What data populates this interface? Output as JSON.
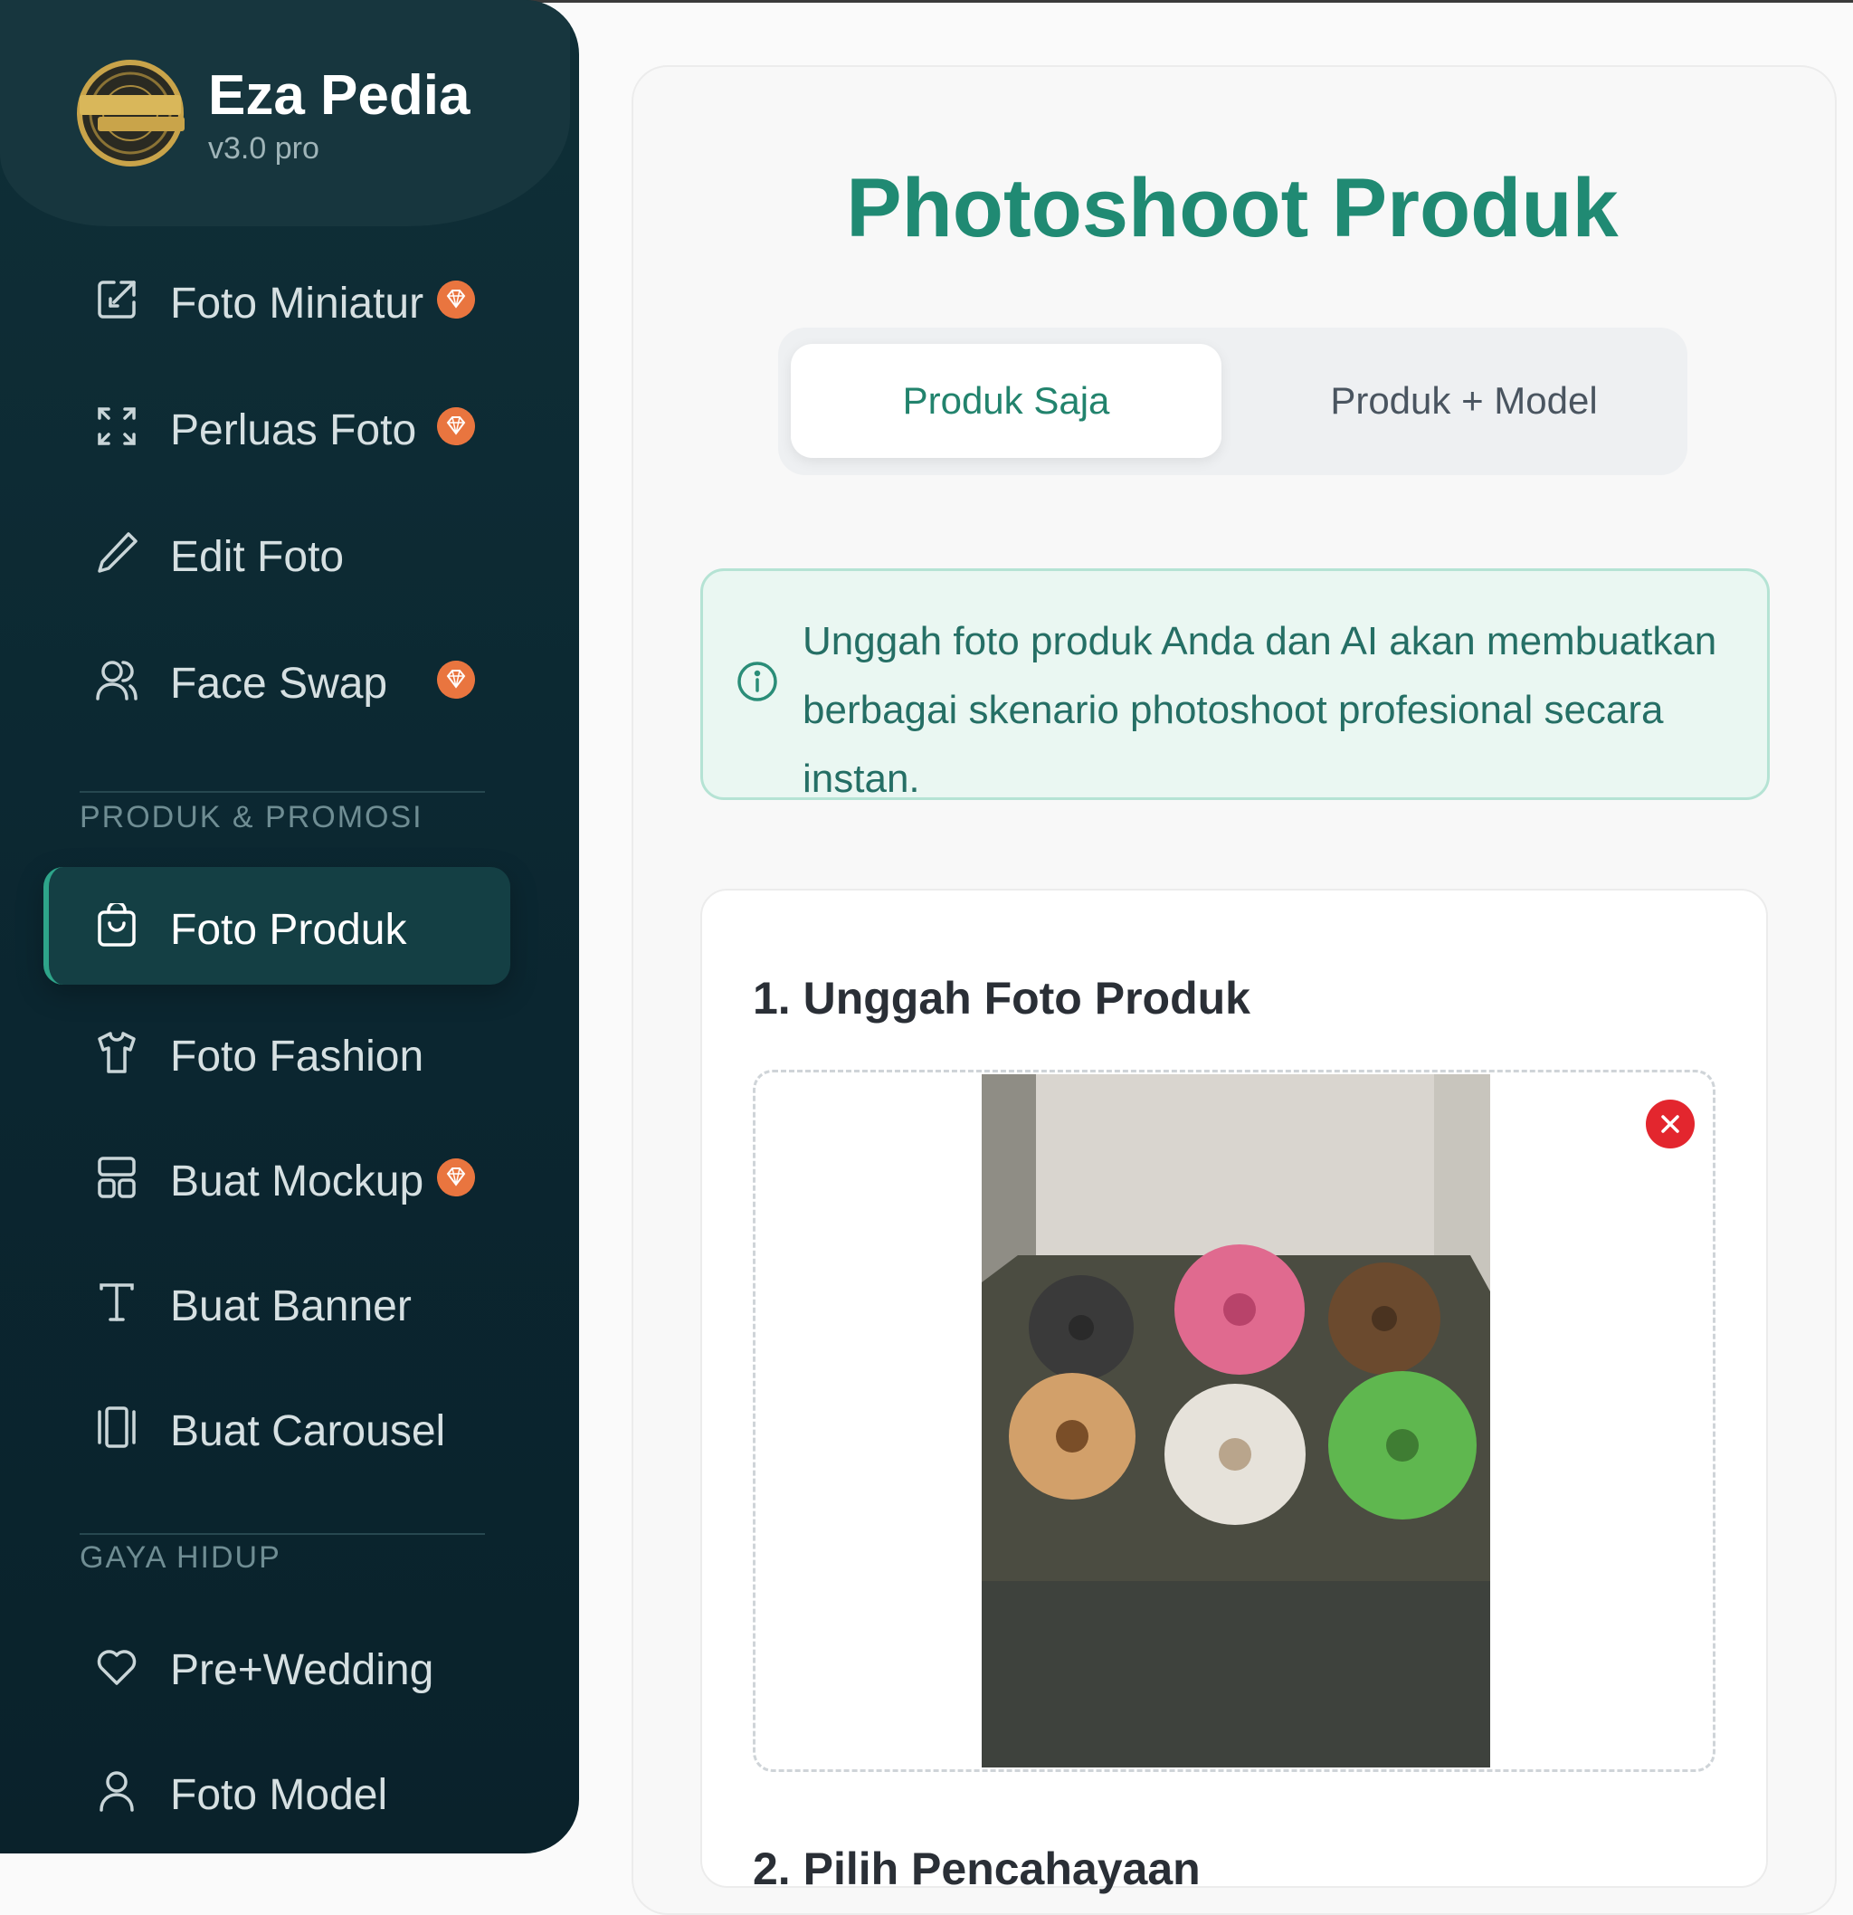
{
  "brand": {
    "title": "Eza Pedia",
    "version": "v3.0 pro",
    "logo_text": "EZA PEDIA PRO"
  },
  "sidebar": {
    "items": [
      {
        "label": "Foto Miniatur",
        "icon": "external-edit-icon",
        "premium": true
      },
      {
        "label": "Perluas Foto",
        "icon": "expand-icon",
        "premium": true
      },
      {
        "label": "Edit Foto",
        "icon": "pencil-icon",
        "premium": false
      },
      {
        "label": "Face Swap",
        "icon": "user-swap-icon",
        "premium": true
      }
    ],
    "section_produk": "PRODUK & PROMOSI",
    "produk_items": [
      {
        "label": "Foto Produk",
        "icon": "shopping-bag-icon",
        "active": true
      },
      {
        "label": "Foto Fashion",
        "icon": "shirt-icon"
      },
      {
        "label": "Buat Mockup",
        "icon": "layout-icon",
        "premium": true
      },
      {
        "label": "Buat Banner",
        "icon": "text-icon"
      },
      {
        "label": "Buat Carousel",
        "icon": "carousel-icon"
      }
    ],
    "section_gaya": "GAYA HIDUP",
    "gaya_items": [
      {
        "label": "Pre+Wedding",
        "icon": "heart-icon"
      },
      {
        "label": "Foto Model",
        "icon": "user-icon"
      }
    ]
  },
  "main": {
    "title": "Photoshoot Produk",
    "tabs": [
      {
        "label": "Produk Saja",
        "active": true
      },
      {
        "label": "Produk + Model",
        "active": false
      }
    ],
    "info_line1": "Unggah foto produk Anda dan AI akan membuatkan",
    "info_line2": "berbagai skenario photoshoot profesional secara instan.",
    "step1_title": "1. Unggah Foto Produk",
    "step2_title": "2. Pilih Pencahayaan"
  },
  "colors": {
    "accent": "#208a73",
    "sidebar_bg": "#0b2630",
    "premium_badge": "#e9753f",
    "remove": "#e3262e"
  }
}
